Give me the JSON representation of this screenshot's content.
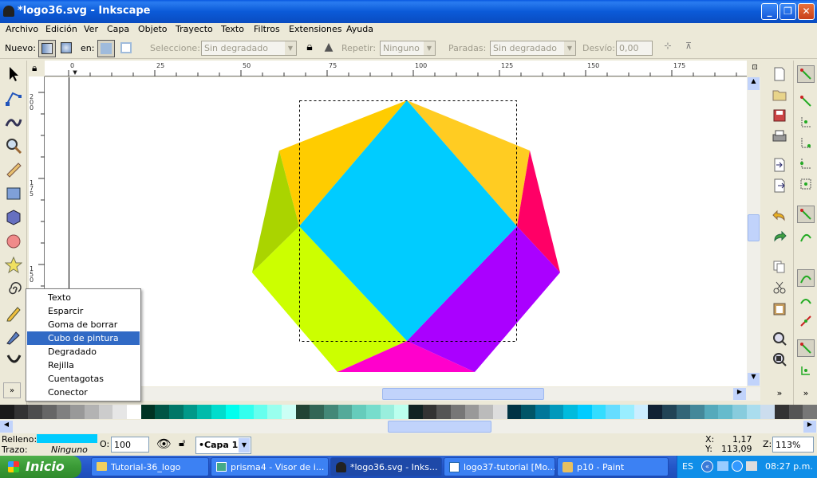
{
  "window": {
    "title": "*logo36.svg - Inkscape"
  },
  "menu": [
    "Archivo",
    "Edición",
    "Ver",
    "Capa",
    "Objeto",
    "Trayecto",
    "Texto",
    "Filtros",
    "Extensiones",
    "Ayuda"
  ],
  "controls": {
    "nuevo": "Nuevo:",
    "en": "en:",
    "seleccione": "Seleccione:",
    "seleccione_val": "Sin degradado",
    "repetir": "Repetir:",
    "repetir_val": "Ninguno",
    "paradas": "Paradas:",
    "paradas_val": "Sin degradado",
    "desvio": "Desvío:",
    "desvio_val": "0,00"
  },
  "ruler": {
    "top": [
      "0",
      "25",
      "50",
      "75",
      "100",
      "125",
      "150",
      "175"
    ],
    "left": [
      "200",
      "175",
      "150"
    ]
  },
  "flyout_menu": {
    "items": [
      "Texto",
      "Esparcir",
      "Goma de borrar",
      "Cubo de pintura",
      "Degradado",
      "Rejilla",
      "Cuentagotas",
      "Conector"
    ],
    "selected_index": 3
  },
  "status": {
    "relleno_label": "Relleno:",
    "trazo_label": "Trazo:",
    "relleno_color": "#00ccff",
    "trazo_val": "Ninguno",
    "opacity_label": "O:",
    "opacity_val": "100",
    "layer": "•Capa 1",
    "x_label": "X:",
    "x_val": "1,17",
    "y_label": "Y:",
    "y_val": "113,09",
    "zoom_label": "Z:",
    "zoom_val": "113%"
  },
  "taskbar": {
    "start": "Inicio",
    "tasks": [
      "Tutorial-36_logo",
      "prisma4 - Visor de i...",
      "*logo36.svg - Inks...",
      "logo37-tutorial [Mo...",
      "p10 - Paint"
    ],
    "lang": "ES",
    "clock": "08:27 p.m."
  },
  "colors": {
    "center": "#00ccff",
    "top_left": "#ffcc00",
    "top_right": "#ffcc22",
    "left": "#aad400",
    "right": "#ff0066",
    "bottom_left": "#ccff00",
    "bottom_right": "#aa00ff",
    "bottom": "#ff00cc"
  },
  "palette": [
    "#1a1a1a",
    "#333333",
    "#4d4d4d",
    "#666666",
    "#808080",
    "#999999",
    "#b3b3b3",
    "#cccccc",
    "#e6e6e6",
    "#ffffff",
    "#003322",
    "#005544",
    "#007766",
    "#009988",
    "#00bbaa",
    "#00ddcc",
    "#00ffee",
    "#33ffee",
    "#66ffee",
    "#99ffee",
    "#ccfff5",
    "#224433",
    "#336655",
    "#448877",
    "#55aa99",
    "#66ccbb",
    "#77ddcc",
    "#99eedd",
    "#bbffee",
    "#112222",
    "#333333",
    "#555555",
    "#777777",
    "#999999",
    "#bbbbbb",
    "#dddddd",
    "#003344",
    "#005566",
    "#007799",
    "#0099bb",
    "#00bbdd",
    "#00ccff",
    "#33ddff",
    "#66ddff",
    "#99eeff",
    "#cceeff",
    "#112233",
    "#224455",
    "#336677",
    "#448899",
    "#55aabb",
    "#66bbcc",
    "#88ccdd",
    "#aaddee",
    "#ccddee",
    "#333333",
    "#555555",
    "#777777"
  ]
}
